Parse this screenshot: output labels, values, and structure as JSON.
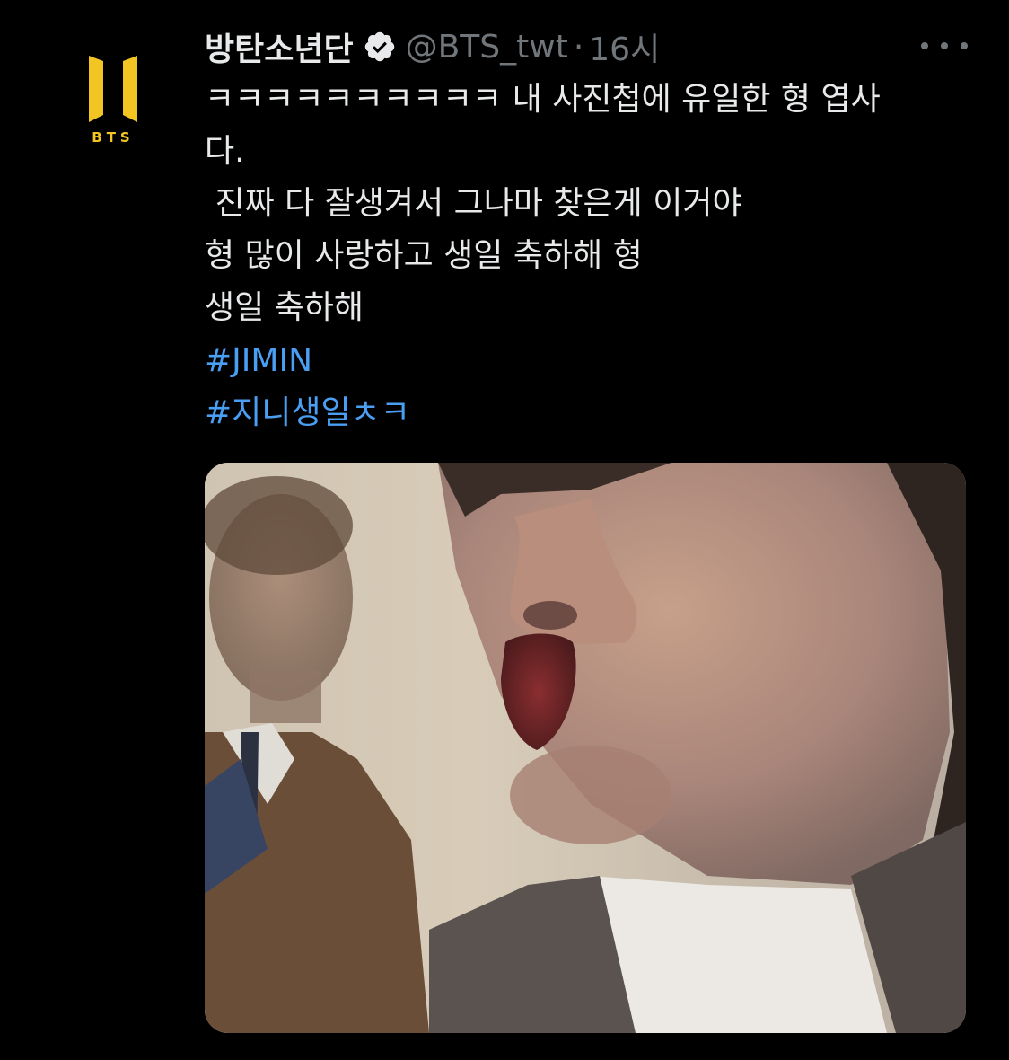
{
  "tweet": {
    "author": {
      "display_name": "방탄소년단",
      "handle": "@BTS_twt",
      "separator": "·",
      "time": "16시",
      "avatar_logo_text": "BTS",
      "avatar_icon": "bts-logo-icon",
      "verified_icon": "verified-badge-icon"
    },
    "more_icon": "more-options-icon",
    "lines": [
      "ㅋㅋㅋㅋㅋㅋㅋㅋㅋㅋ 내 사진첩에 유일한 형 엽사",
      "다.",
      " 진짜 다 잘생겨서 그나마 찾은게 이거야",
      "형 많이 사랑하고 생일 축하해 형",
      "생일 축하해"
    ],
    "hashtags": [
      "#JIMIN",
      "#지니생일ㅊㅋ"
    ],
    "media": {
      "kind": "photo"
    }
  },
  "colors": {
    "background": "#000000",
    "text": "#e7e9ea",
    "muted": "#71767b",
    "hashtag": "#4a9ff5",
    "brand_gold": "#f3c522"
  }
}
